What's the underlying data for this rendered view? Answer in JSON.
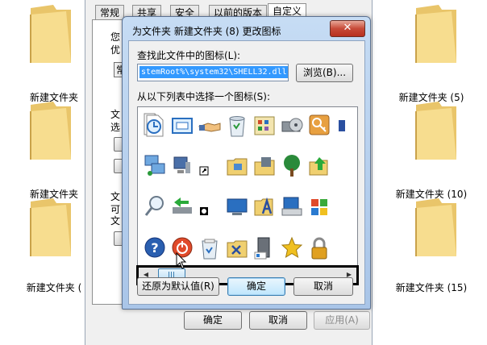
{
  "explorer": {
    "folders_left": [
      "新建文件夹",
      "新建文件夹",
      "新建文件夹 ("
    ],
    "folders_right": [
      "新建文件夹 (5)",
      "新建文件夹 (10)",
      "新建文件夹 (15)"
    ]
  },
  "props": {
    "tabs": [
      "常规",
      "共享",
      "安全",
      "以前的版本",
      "自定义"
    ],
    "fragments": [
      "您",
      "优",
      "常",
      "文",
      "选",
      "文",
      "可",
      "文"
    ],
    "footer": {
      "ok": "确定",
      "cancel": "取消",
      "apply": "应用(A)"
    }
  },
  "dialog": {
    "title": "为文件夹 新建文件夹 (8) 更改图标",
    "close_glyph": "✕",
    "find_label": "查找此文件中的图标(L):",
    "path_value": "stemRoot%\\system32\\SHELL32.dll",
    "browse_label": "浏览(B)...",
    "list_label": "从以下列表中选择一个图标(S):",
    "restore_label": "还原为默认值(R)",
    "ok_label": "确定",
    "cancel_label": "取消",
    "scroll_left": "◀",
    "scroll_right": "▶"
  },
  "icons": [
    [
      "blank-document-icon",
      "clock-document-icon",
      "window-icon",
      "handshake-icon",
      "recycle-bin-icon",
      "control-panel-icon",
      "dvd-drive-icon",
      "key-icon",
      "partial-icon"
    ],
    [
      "network-computer-icon",
      "monitor-icon",
      "shortcut-arrow-icon",
      "folder-options-icon",
      "floppy-folder-icon",
      "tree-icon",
      "folder-up-arrow-icon"
    ],
    [
      "search-icon",
      "green-arrow-drive-icon",
      "small-disc-icon",
      "desktop-icon",
      "font-folder-icon",
      "printer-computer-icon",
      "windows-logo-icon"
    ],
    [
      "help-icon",
      "power-icon",
      "recycle-bin-full-icon",
      "tools-folder-icon",
      "computer-tower-icon",
      "favorite-star-icon",
      "padlock-icon"
    ]
  ],
  "colors": {
    "selection": "#3399ff",
    "highlight_border": "#000000"
  }
}
